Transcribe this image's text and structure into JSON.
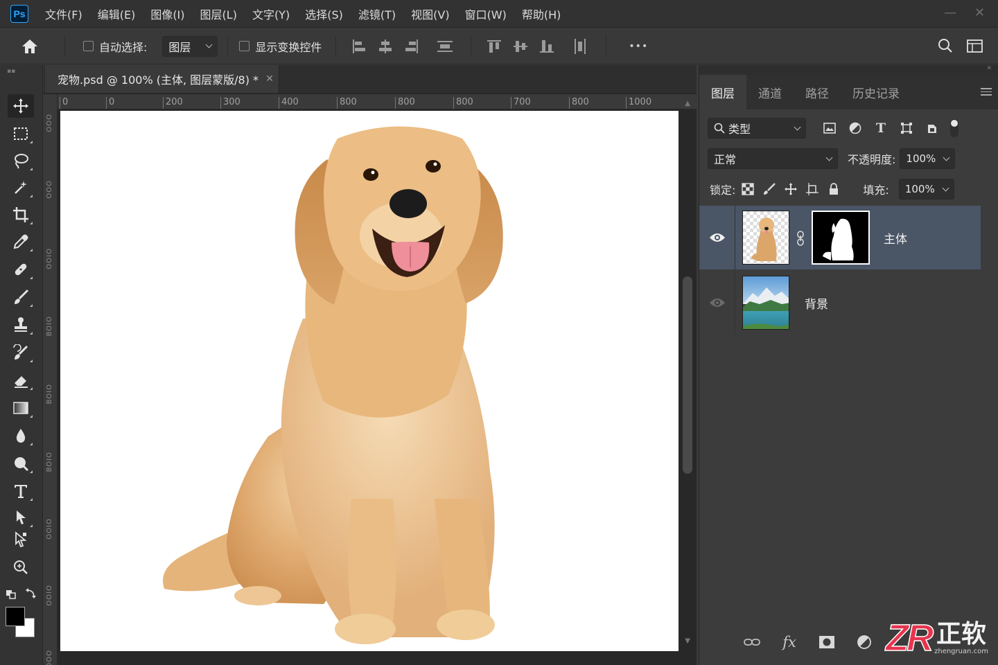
{
  "app": {
    "logo": "Ps",
    "menu": [
      "文件(F)",
      "编辑(E)",
      "图像(I)",
      "图层(L)",
      "文字(Y)",
      "选择(S)",
      "滤镜(T)",
      "视图(V)",
      "窗口(W)",
      "帮助(H)"
    ]
  },
  "options": {
    "auto_select_label": "自动选择:",
    "auto_select_value": "图层",
    "show_transform_label": "显示变换控件",
    "more_label": "•••"
  },
  "document": {
    "tab_title": "宠物.psd @ 100% (主体, 图层蒙版/8) *",
    "ruler_h": [
      "0",
      "0",
      "200",
      "300",
      "400",
      "800",
      "800",
      "800",
      "700",
      "800",
      "1000"
    ],
    "ruler_v": [
      "OOO",
      "OOO",
      "OOIO",
      "BOIO",
      "BOIO",
      "BOIO",
      "OOIO",
      "OOIO",
      "OOO"
    ]
  },
  "layers_panel": {
    "tabs": [
      "图层",
      "通道",
      "路径",
      "历史记录"
    ],
    "filter_kind": "类型",
    "blend_mode": "正常",
    "opacity_label": "不透明度:",
    "opacity_value": "100%",
    "lock_label": "锁定:",
    "fill_label": "填充:",
    "fill_value": "100%",
    "layers": [
      {
        "name": "主体",
        "visible": true,
        "selected": true
      },
      {
        "name": "背景",
        "visible": true,
        "selected": false
      }
    ],
    "bottom_fx": "fx"
  },
  "watermark": {
    "logo": "ZR",
    "brand": "正软",
    "site": "zhengruan.com"
  },
  "colors": {
    "accent": "#31a8ff",
    "selected_layer": "#4a5566",
    "watermark_red": "#e8344e"
  }
}
